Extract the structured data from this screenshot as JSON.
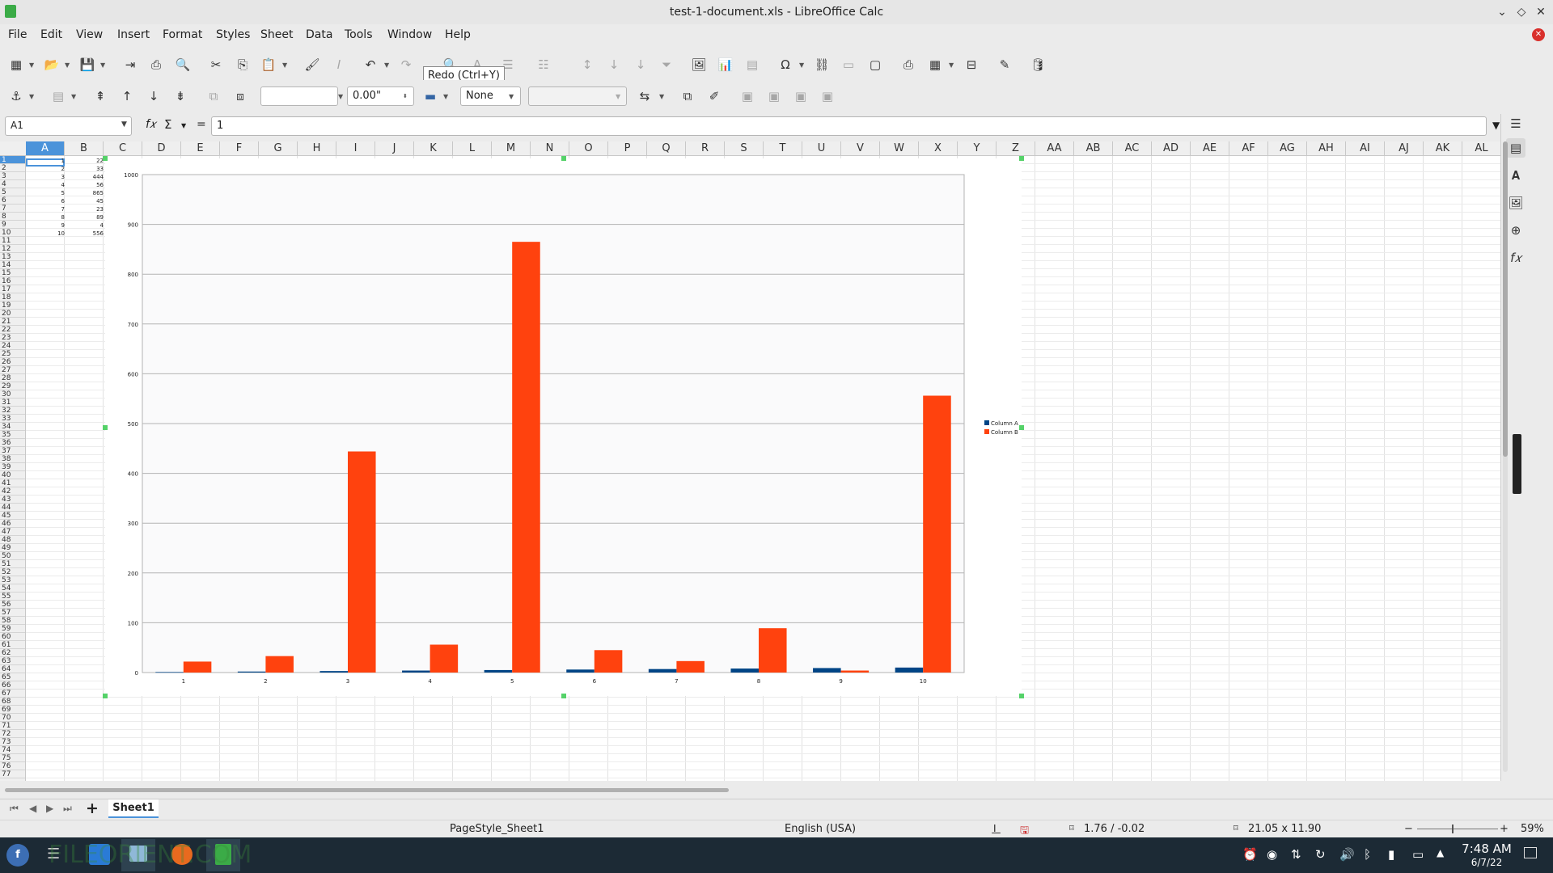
{
  "window": {
    "title": "test-1-document.xls - LibreOffice Calc"
  },
  "menu": [
    "File",
    "Edit",
    "View",
    "Insert",
    "Format",
    "Styles",
    "Sheet",
    "Data",
    "Tools",
    "Window",
    "Help"
  ],
  "tooltip": "Redo (Ctrl+Y)",
  "toolbar2": {
    "font_name": "",
    "spacing_value": "0.00\"",
    "line_style": "None",
    "area_value": ""
  },
  "formula_bar": {
    "name_box": "A1",
    "content": "1",
    "equals": "="
  },
  "columns": [
    "A",
    "B",
    "C",
    "D",
    "E",
    "F",
    "G",
    "H",
    "I",
    "J",
    "K",
    "L",
    "M",
    "N",
    "O",
    "P",
    "Q",
    "R",
    "S",
    "T",
    "U",
    "V",
    "W",
    "X",
    "Y",
    "Z",
    "AA",
    "AB",
    "AC",
    "AD",
    "AE",
    "AF",
    "AG",
    "AH",
    "AI",
    "AJ",
    "AK",
    "AL"
  ],
  "rows_visible": 77,
  "cells": {
    "A": [
      "1",
      "2",
      "3",
      "4",
      "5",
      "6",
      "7",
      "8",
      "9",
      "10"
    ],
    "B": [
      "22",
      "33",
      "444",
      "56",
      "865",
      "45",
      "23",
      "89",
      "4",
      "556"
    ]
  },
  "chart_data": {
    "type": "bar",
    "categories": [
      "1",
      "2",
      "3",
      "4",
      "5",
      "6",
      "7",
      "8",
      "9",
      "10"
    ],
    "series": [
      {
        "name": "Column A",
        "values": [
          1,
          2,
          3,
          4,
          5,
          6,
          7,
          8,
          9,
          10
        ],
        "color": "#004586"
      },
      {
        "name": "Column B",
        "values": [
          22,
          33,
          444,
          56,
          865,
          45,
          23,
          89,
          4,
          556
        ],
        "color": "#ff420e"
      }
    ],
    "ylim": [
      0,
      1000
    ],
    "yticks": [
      "0",
      "100",
      "200",
      "300",
      "400",
      "500",
      "600",
      "700",
      "800",
      "900",
      "1000"
    ],
    "grid": true,
    "legend": "right"
  },
  "sheet_tab": "Sheet1",
  "statusbar": {
    "page_style": "PageStyle_Sheet1",
    "language": "English (USA)",
    "position": "1.76 / -0.02",
    "size": "21.05 x 11.90",
    "zoom": "59%"
  },
  "taskbar": {
    "time": "7:48 AM",
    "date": "6/7/22",
    "watermark": "FILEORIENT.COM"
  },
  "colors": {
    "selection": "#4b93da",
    "handle": "#55d269",
    "taskbar": "#1c2a35"
  }
}
